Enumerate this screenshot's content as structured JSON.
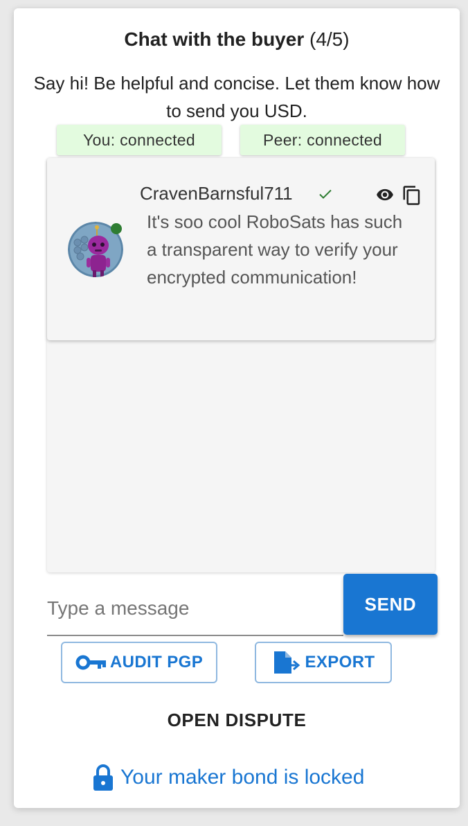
{
  "header": {
    "title_bold": "Chat with the buyer",
    "title_step": "(4/5)",
    "subtitle": "Say hi! Be helpful and concise. Let them know how to send you USD."
  },
  "status": {
    "you": "You: connected",
    "peer": "Peer: connected",
    "color": "#e3fbdf"
  },
  "message": {
    "nickname": "CravenBarnsful711",
    "text": "It's soo cool RoboSats has such a transparent way to verify your encrypted communication!",
    "icons": [
      "check-icon",
      "eye-icon",
      "copy-icon"
    ]
  },
  "composer": {
    "placeholder": "Type a message",
    "send_label": "SEND"
  },
  "actions": {
    "audit_label": "AUDIT PGP",
    "export_label": "EXPORT",
    "dispute_label": "OPEN DISPUTE"
  },
  "bond": {
    "text": "Your maker bond is locked"
  },
  "colors": {
    "primary": "#1976d2",
    "online": "#2e7d32",
    "connected_bg": "#e3fbdf"
  }
}
